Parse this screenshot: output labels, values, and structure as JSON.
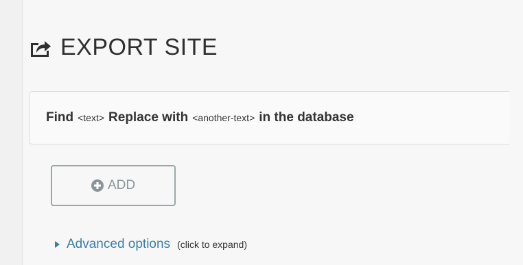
{
  "header": {
    "title": "EXPORT SITE",
    "icon": "share-export-icon"
  },
  "replace_rule": {
    "find_label": "Find",
    "find_value": "<text>",
    "replace_label": "Replace with",
    "replace_value": "<another-text>",
    "suffix": "in the database"
  },
  "actions": {
    "add_label": "ADD",
    "add_icon": "plus-circle-icon"
  },
  "advanced": {
    "label": "Advanced options",
    "hint": "(click to expand)",
    "icon": "triangle-right-icon"
  },
  "colors": {
    "link": "#3d7ea6",
    "button_border": "#9aa7a9",
    "button_text": "#8b9598",
    "panel_bg": "#f7f7f7"
  }
}
